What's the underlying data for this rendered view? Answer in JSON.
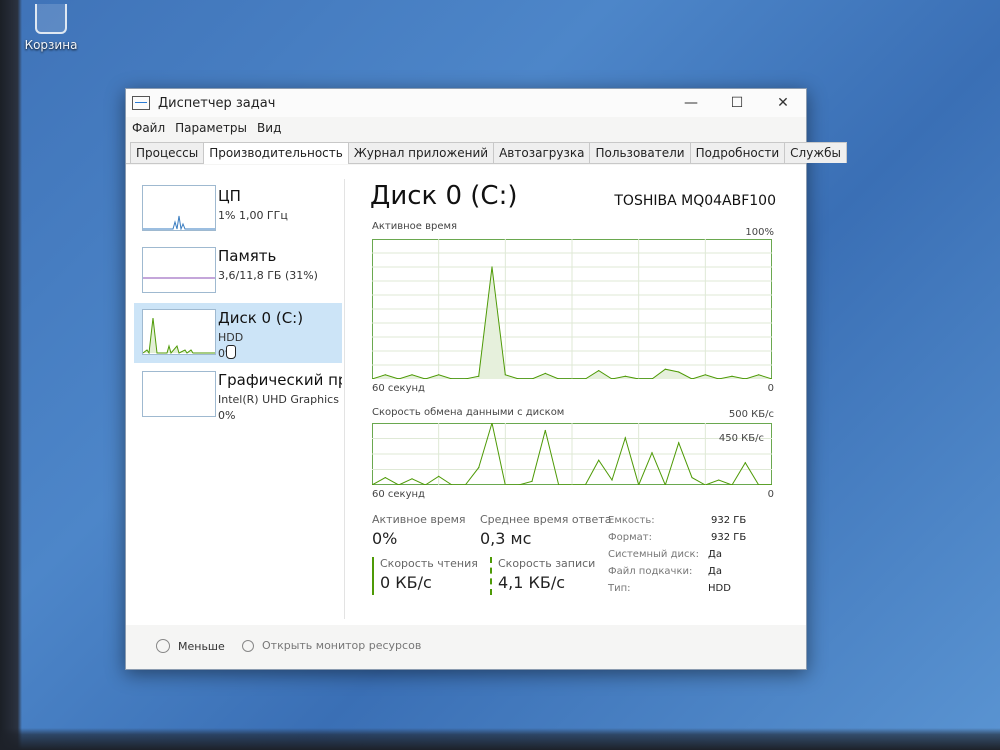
{
  "desktop": {
    "recycle_label": "Корзина"
  },
  "window": {
    "title": "Диспетчер задач",
    "controls": {
      "minimize": "—",
      "maximize": "☐",
      "close": "✕"
    }
  },
  "menu": [
    "Файл",
    "Параметры",
    "Вид"
  ],
  "tabs": [
    "Процессы",
    "Производительность",
    "Журнал приложений",
    "Автозагрузка",
    "Пользователи",
    "Подробности",
    "Службы"
  ],
  "active_tab": "Производительность",
  "sidebar": {
    "items": [
      {
        "title": "ЦП",
        "line1": "1% 1,00 ГГц",
        "line2": ""
      },
      {
        "title": "Память",
        "line1": "3,6/11,8 ГБ (31%)",
        "line2": ""
      },
      {
        "title": "Диск 0 (C:)",
        "line1": "HDD",
        "line2": "0%"
      },
      {
        "title": "Графический процессор",
        "line1": "Intel(R) UHD Graphics",
        "line2": "0%"
      }
    ],
    "selected_index": 2
  },
  "main": {
    "title": "Диск 0 (C:)",
    "model": "TOSHIBA MQ04ABF100",
    "graph1": {
      "label": "Активное время",
      "max_label": "100%",
      "time_label": "60 секунд",
      "min_label": "0"
    },
    "graph2": {
      "label": "Скорость обмена данными с диском",
      "max_label": "500 КБ/с",
      "time_label": "60 секунд",
      "min_label": "0",
      "mid_label": "450 КБ/с"
    },
    "stats": {
      "active_time_label": "Активное время",
      "active_time_value": "0%",
      "response_label": "Среднее время ответа",
      "response_value": "0,3 мс",
      "read_label": "Скорость чтения",
      "read_value": "0 КБ/с",
      "write_label": "Скорость записи",
      "write_value": "4,1 КБ/с"
    },
    "properties": [
      {
        "label": "Емкость:",
        "value": "932 ГБ"
      },
      {
        "label": "Формат:",
        "value": "932 ГБ"
      },
      {
        "label": "Системный диск:",
        "value": "Да"
      },
      {
        "label": "Файл подкачки:",
        "value": "Да"
      },
      {
        "label": "Тип:",
        "value": "HDD"
      }
    ]
  },
  "footer": {
    "less_label": "Меньше",
    "monitor_label": "Открыть монитор ресурсов"
  },
  "chart_data": [
    {
      "type": "area",
      "x": [
        0,
        2,
        4,
        6,
        8,
        10,
        12,
        14,
        16,
        18,
        20,
        22,
        24,
        26,
        28,
        30,
        32,
        34,
        36,
        38,
        40,
        42,
        44,
        46,
        48,
        50,
        52,
        54,
        56,
        58,
        60
      ],
      "series": [
        {
          "values": [
            0,
            3,
            0,
            3,
            0,
            3,
            0,
            0,
            2,
            80,
            3,
            0,
            0,
            4,
            0,
            0,
            0,
            6,
            0,
            2,
            0,
            0,
            7,
            5,
            0,
            3,
            0,
            2,
            0,
            3,
            0
          ]
        }
      ],
      "ylim": [
        0,
        100
      ],
      "grid": true
    },
    {
      "type": "line",
      "x": [
        0,
        2,
        4,
        6,
        8,
        10,
        12,
        14,
        16,
        18,
        20,
        22,
        24,
        26,
        28,
        30,
        32,
        34,
        36,
        38,
        40,
        42,
        44,
        46,
        48,
        50,
        52,
        54,
        56,
        58,
        60
      ],
      "series": [
        {
          "values": [
            0,
            60,
            0,
            50,
            0,
            70,
            0,
            0,
            140,
            500,
            0,
            0,
            30,
            440,
            0,
            0,
            0,
            200,
            40,
            380,
            0,
            260,
            0,
            340,
            60,
            0,
            40,
            0,
            180,
            0,
            0
          ]
        }
      ],
      "ylim": [
        0,
        500
      ],
      "grid": true
    }
  ]
}
